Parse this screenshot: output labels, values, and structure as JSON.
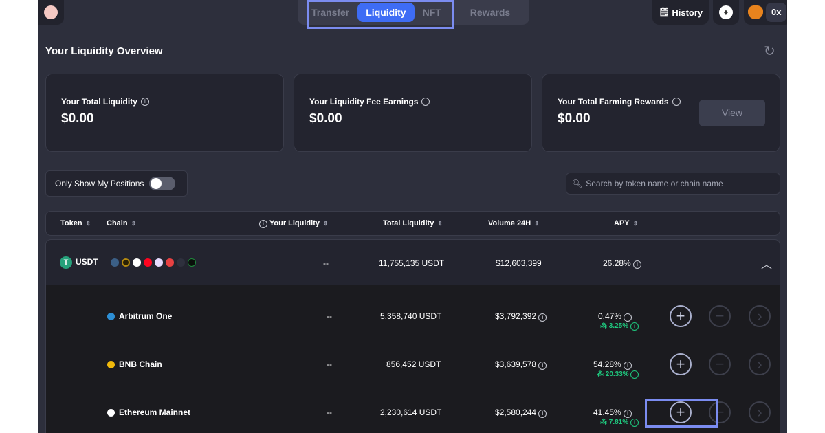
{
  "nav": {
    "tabs": [
      {
        "label": "Transfer"
      },
      {
        "label": "Liquidity",
        "active": true
      },
      {
        "label": "NFT"
      },
      {
        "label": "Rewards"
      }
    ],
    "history_label": "History",
    "wallet_address": "0x"
  },
  "overview": {
    "title": "Your Liquidity Overview",
    "cards": [
      {
        "label": "Your Total Liquidity",
        "value": "$0.00"
      },
      {
        "label": "Your Liquidity Fee Earnings",
        "value": "$0.00"
      },
      {
        "label": "Your Total Farming Rewards",
        "value": "$0.00",
        "button": "View"
      }
    ]
  },
  "filters": {
    "only_my_positions": "Only Show My Positions",
    "only_my_positions_on": false,
    "search_placeholder": "Search by token name or chain name"
  },
  "table": {
    "columns": [
      "Token",
      "Chain",
      "Your Liquidity",
      "Total Liquidity",
      "Volume 24H",
      "APY"
    ],
    "group": {
      "token": "USDT",
      "your_liquidity": "--",
      "total_liquidity": "11,755,135 USDT",
      "volume": "$12,603,399",
      "apy": "26.28%"
    },
    "rows": [
      {
        "chain": "Arbitrum One",
        "your_liquidity": "--",
        "total_liquidity": "5,358,740 USDT",
        "volume": "$3,792,392",
        "apy": "0.47%",
        "farm_apy": "3.25%",
        "icon_color": "#2d8fd5"
      },
      {
        "chain": "BNB Chain",
        "your_liquidity": "--",
        "total_liquidity": "856,452 USDT",
        "volume": "$3,639,578",
        "apy": "54.28%",
        "farm_apy": "20.33%",
        "icon_color": "#f0b90b"
      },
      {
        "chain": "Ethereum Mainnet",
        "your_liquidity": "--",
        "total_liquidity": "2,230,614 USDT",
        "volume": "$2,580,244",
        "apy": "41.45%",
        "farm_apy": "7.81%",
        "icon_color": "#ffffff"
      }
    ]
  },
  "colors": {
    "accent": "#3e6cf5",
    "positive": "#1fc87e",
    "highlight": "#7b8cf0"
  }
}
